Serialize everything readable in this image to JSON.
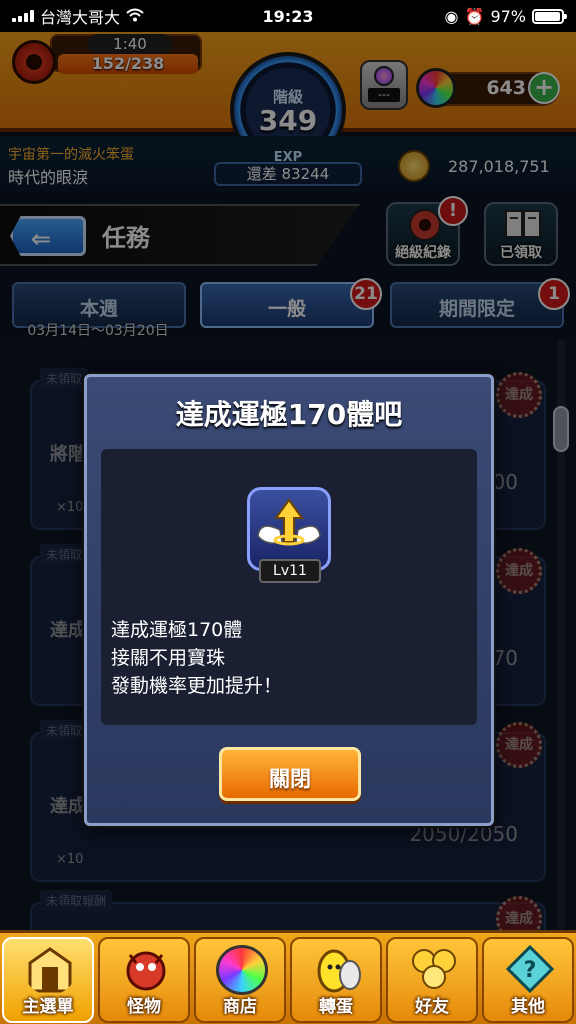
{
  "status_bar": {
    "carrier": "台灣大哥大",
    "time": "19:23",
    "battery": "97%",
    "battery_level": 0.97
  },
  "hud": {
    "stamina_timer": "1:40",
    "stamina": "152/238",
    "stamina_fraction": 0.64,
    "rank_label": "階級",
    "rank": "349",
    "monster_box_label": "---",
    "gems": "643",
    "gem_plus": "+"
  },
  "info": {
    "title_line1": "宇宙第一的滅火笨蛋",
    "title_line2": "時代的眼淚",
    "exp_label": "EXP",
    "exp_remaining": "還差 83244",
    "coins": "287,018,751"
  },
  "header": {
    "back_arrow": "⇐",
    "title": "任務",
    "btn_records": "絕級紀錄",
    "btn_claimed": "已領取",
    "alert_mark": "!"
  },
  "tabs": [
    {
      "label": "本週",
      "date": "03月14日～03月20日"
    },
    {
      "label": "一般",
      "badge": "21"
    },
    {
      "label": "期間限定",
      "badge": "1"
    }
  ],
  "background_list": {
    "tags": [
      "未領取",
      "未領取",
      "未領取",
      "未領取報酬"
    ],
    "names": [
      "將階",
      "達成",
      "達成"
    ],
    "progress": [
      "00",
      "70",
      "2050/2050"
    ],
    "reward_count": "×10",
    "stamp": "達成"
  },
  "modal": {
    "title": "達成運極170體吧",
    "skill_level": "Lv11",
    "description": [
      "達成運極170體",
      "接關不用寶珠",
      "發動機率更加提升！"
    ],
    "close_label": "關閉"
  },
  "bottom_nav": [
    {
      "label": "主選單",
      "icon": "home-gate-icon",
      "active": true
    },
    {
      "label": "怪物",
      "icon": "dragon-icon"
    },
    {
      "label": "商店",
      "icon": "rainbow-orb-icon"
    },
    {
      "label": "轉蛋",
      "icon": "egg-icon"
    },
    {
      "label": "好友",
      "icon": "balloons-icon"
    },
    {
      "label": "其他",
      "icon": "question-diamond-icon"
    }
  ],
  "colors": {
    "hud_orange": "#f7a21c",
    "panel_navy": "#2a385e",
    "close_orange": "#e86a00",
    "badge_red": "#d41a1a"
  }
}
